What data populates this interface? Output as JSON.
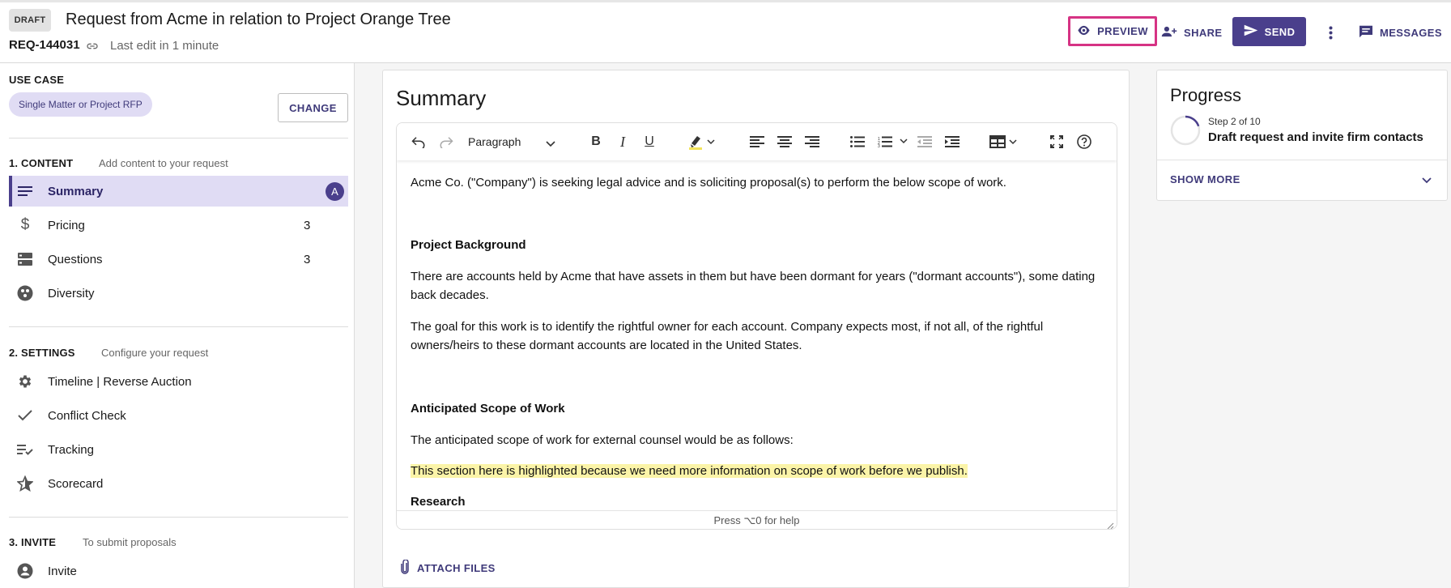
{
  "header": {
    "badge": "DRAFT",
    "title": "Request from Acme in relation to Project Orange Tree",
    "req_id": "REQ-144031",
    "last_edit": "Last edit in 1 minute",
    "preview": "PREVIEW",
    "share": "SHARE",
    "send": "SEND",
    "messages": "MESSAGES"
  },
  "sidebar": {
    "use_case_label": "USE CASE",
    "use_case_value": "Single Matter or Project RFP",
    "change": "CHANGE",
    "content": {
      "label": "1. CONTENT",
      "desc": "Add content to your request",
      "items": [
        {
          "label": "Summary",
          "badge": "A",
          "icon": "lines-icon"
        },
        {
          "label": "Pricing",
          "count": "3",
          "icon": "dollar-icon"
        },
        {
          "label": "Questions",
          "count": "3",
          "icon": "storage-icon"
        },
        {
          "label": "Diversity",
          "icon": "diversity-icon"
        }
      ]
    },
    "settings": {
      "label": "2. SETTINGS",
      "desc": "Configure your request",
      "items": [
        {
          "label": "Timeline | Reverse Auction",
          "icon": "gear-icon"
        },
        {
          "label": "Conflict Check",
          "icon": "check-icon"
        },
        {
          "label": "Tracking",
          "icon": "checklist-icon"
        },
        {
          "label": "Scorecard",
          "icon": "star-icon"
        }
      ]
    },
    "invite": {
      "label": "3. INVITE",
      "desc": "To submit proposals",
      "items": [
        {
          "label": "Invite",
          "icon": "person-icon"
        }
      ]
    }
  },
  "main": {
    "title": "Summary",
    "toolbar": {
      "paragraph": "Paragraph"
    },
    "paragraphs": {
      "p1": "Acme Co. (\"Company\") is seeking legal advice and is soliciting proposal(s) to perform the below scope of work.",
      "h1": "Project Background",
      "p2": "There are accounts held by Acme that have assets in them but have been dormant for years (\"dormant accounts\"), some dating back decades.",
      "p3": "The goal for this work is to identify the rightful owner for each account. Company expects most, if not all, of the rightful owners/heirs to these dormant accounts are located in the United States.",
      "h2": "Anticipated Scope of Work",
      "p4": "The anticipated scope of work for external counsel would be as follows:",
      "p5": "This section here is highlighted because we need more information on scope of work before we publish.",
      "h3": "Research"
    },
    "help_hint": "Press ⌥0 for help",
    "attach": "ATTACH FILES"
  },
  "progress": {
    "title": "Progress",
    "step": "Step 2 of 10",
    "desc": "Draft request and invite firm contacts",
    "fraction": 0.2,
    "show_more": "SHOW MORE"
  },
  "colors": {
    "accent": "#4a3f8c",
    "accent_light": "#e0dcf4",
    "focus": "#d63384",
    "highlight": "#fbf4a8"
  }
}
